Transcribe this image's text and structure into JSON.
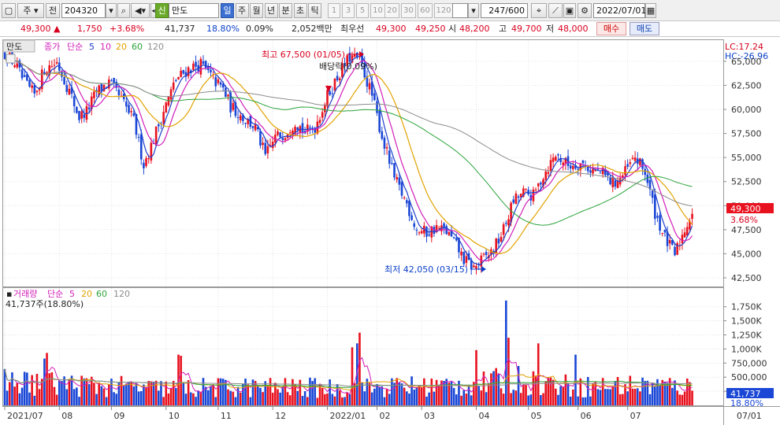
{
  "toolbar": {
    "period_select": "주",
    "prev_label": "전",
    "code": "204320",
    "new_badge": "신",
    "name": "만도",
    "period_tabs": [
      "일",
      "주",
      "월",
      "년",
      "분",
      "초",
      "틱"
    ],
    "active_period": "일",
    "intervals": [
      "1",
      "3",
      "5",
      "10",
      "20",
      "30",
      "60",
      "120"
    ],
    "count": "247/600",
    "date": "2022/07/01"
  },
  "quote": {
    "price": "49,300",
    "change": "1,750",
    "change_pct": "+3.68%",
    "volume": "41,737",
    "volume_ratio": "18.80%",
    "turnover": "0.09%",
    "amount": "2,052백만",
    "label_best": "최우선",
    "best_ask": "49,300",
    "best_bid": "49,250",
    "label_open": "시",
    "open": "48,200",
    "label_high": "고",
    "high": "49,700",
    "label_low": "저",
    "low": "48,000",
    "sell_button": "매수",
    "buy_button": "매도"
  },
  "price_panel": {
    "tab": "만도",
    "ma_label": "종가",
    "ma_type": "단순",
    "ma_periods": [
      "5",
      "10",
      "20",
      "60",
      "120"
    ],
    "lc": "LC:17.24",
    "hc": "HC:-26.96",
    "high_note": "최고 67,500 (01/05)",
    "div_note": "배당락(0.09%)",
    "low_note": "최저 42,050 (03/15)",
    "current_price": "49,300",
    "current_pct": "3.68%",
    "y_ticks": [
      "65,000",
      "62,500",
      "60,000",
      "57,500",
      "55,000",
      "52,500",
      "50,000",
      "47,500",
      "45,000",
      "42,500"
    ]
  },
  "volume_panel": {
    "label": "거래량",
    "ma_type": "단순",
    "ma_periods": [
      "5",
      "20",
      "60",
      "120"
    ],
    "current_volume": "41,737주(18.80%)",
    "current_vol_tag": "41,737",
    "current_pct_tag": "18.80%",
    "y_ticks": [
      "1,750K",
      "1,500K",
      "1,250K",
      "1,000K",
      "750,000",
      "500,000",
      "250,000"
    ]
  },
  "x_axis": {
    "labels": [
      "2021/07",
      "08",
      "09",
      "10",
      "11",
      "12",
      "2022/01",
      "02",
      "03",
      "04",
      "05",
      "06",
      "07"
    ],
    "end_label": "07/01"
  },
  "colors": {
    "up": "#e8121f",
    "down": "#1a47d6",
    "ma5": "#1f3fcc",
    "ma10": "#d21fb8",
    "ma20": "#e2a300",
    "ma60": "#2aa43a",
    "ma120": "#8c8c8c"
  },
  "chart_data": {
    "type": "candlestick",
    "price_ylim": [
      41600,
      67200
    ],
    "volume_ylim": [
      0,
      1900000
    ],
    "anchors": [
      [
        0,
        65800
      ],
      [
        4,
        64800
      ],
      [
        8,
        62700
      ],
      [
        12,
        61500
      ],
      [
        16,
        64200
      ],
      [
        21,
        64900
      ],
      [
        26,
        61900
      ],
      [
        30,
        59200
      ],
      [
        33,
        59800
      ],
      [
        37,
        61800
      ],
      [
        42,
        62800
      ],
      [
        47,
        61000
      ],
      [
        52,
        58800
      ],
      [
        56,
        54300
      ],
      [
        59,
        56200
      ],
      [
        64,
        59900
      ],
      [
        69,
        63100
      ],
      [
        74,
        64200
      ],
      [
        79,
        64700
      ],
      [
        84,
        63100
      ],
      [
        88,
        62100
      ],
      [
        91,
        60300
      ],
      [
        96,
        59200
      ],
      [
        101,
        58100
      ],
      [
        105,
        55100
      ],
      [
        109,
        57100
      ],
      [
        113,
        57600
      ],
      [
        117,
        58800
      ],
      [
        121,
        57600
      ],
      [
        125,
        58200
      ],
      [
        130,
        61400
      ],
      [
        135,
        63800
      ],
      [
        139,
        65400
      ],
      [
        143,
        65200
      ],
      [
        148,
        61400
      ],
      [
        152,
        57200
      ],
      [
        157,
        52800
      ],
      [
        162,
        50200
      ],
      [
        166,
        47500
      ],
      [
        170,
        47200
      ],
      [
        174,
        47700
      ],
      [
        178,
        47300
      ],
      [
        182,
        45800
      ],
      [
        185,
        44400
      ],
      [
        189,
        43500
      ],
      [
        193,
        44500
      ],
      [
        197,
        45400
      ],
      [
        201,
        47500
      ],
      [
        205,
        50500
      ],
      [
        209,
        51300
      ],
      [
        213,
        51000
      ],
      [
        217,
        53200
      ],
      [
        222,
        55300
      ],
      [
        227,
        54200
      ],
      [
        232,
        54400
      ],
      [
        236,
        53800
      ],
      [
        241,
        53300
      ],
      [
        245,
        52300
      ],
      [
        249,
        53100
      ],
      [
        254,
        55000
      ],
      [
        258,
        53500
      ],
      [
        262,
        49300
      ],
      [
        266,
        46600
      ],
      [
        270,
        44900
      ],
      [
        274,
        47600
      ],
      [
        277,
        49300
      ]
    ],
    "volume_anchors": [
      [
        0,
        420000
      ],
      [
        30,
        360000
      ],
      [
        60,
        300000
      ],
      [
        100,
        320000
      ],
      [
        140,
        300000
      ],
      [
        160,
        330000
      ],
      [
        190,
        360000
      ],
      [
        205,
        460000
      ],
      [
        230,
        330000
      ],
      [
        260,
        360000
      ],
      [
        277,
        320000
      ]
    ],
    "volume_spikes": [
      [
        16,
        830000
      ],
      [
        17,
        930000
      ],
      [
        70,
        900000
      ],
      [
        71,
        880000
      ],
      [
        140,
        1030000
      ],
      [
        142,
        1100000
      ],
      [
        143,
        1290000
      ],
      [
        190,
        980000
      ],
      [
        202,
        1860000
      ],
      [
        203,
        1200000
      ],
      [
        215,
        1100000
      ],
      [
        230,
        900000
      ]
    ],
    "ma_periods": [
      5,
      10,
      20,
      60,
      120
    ]
  }
}
